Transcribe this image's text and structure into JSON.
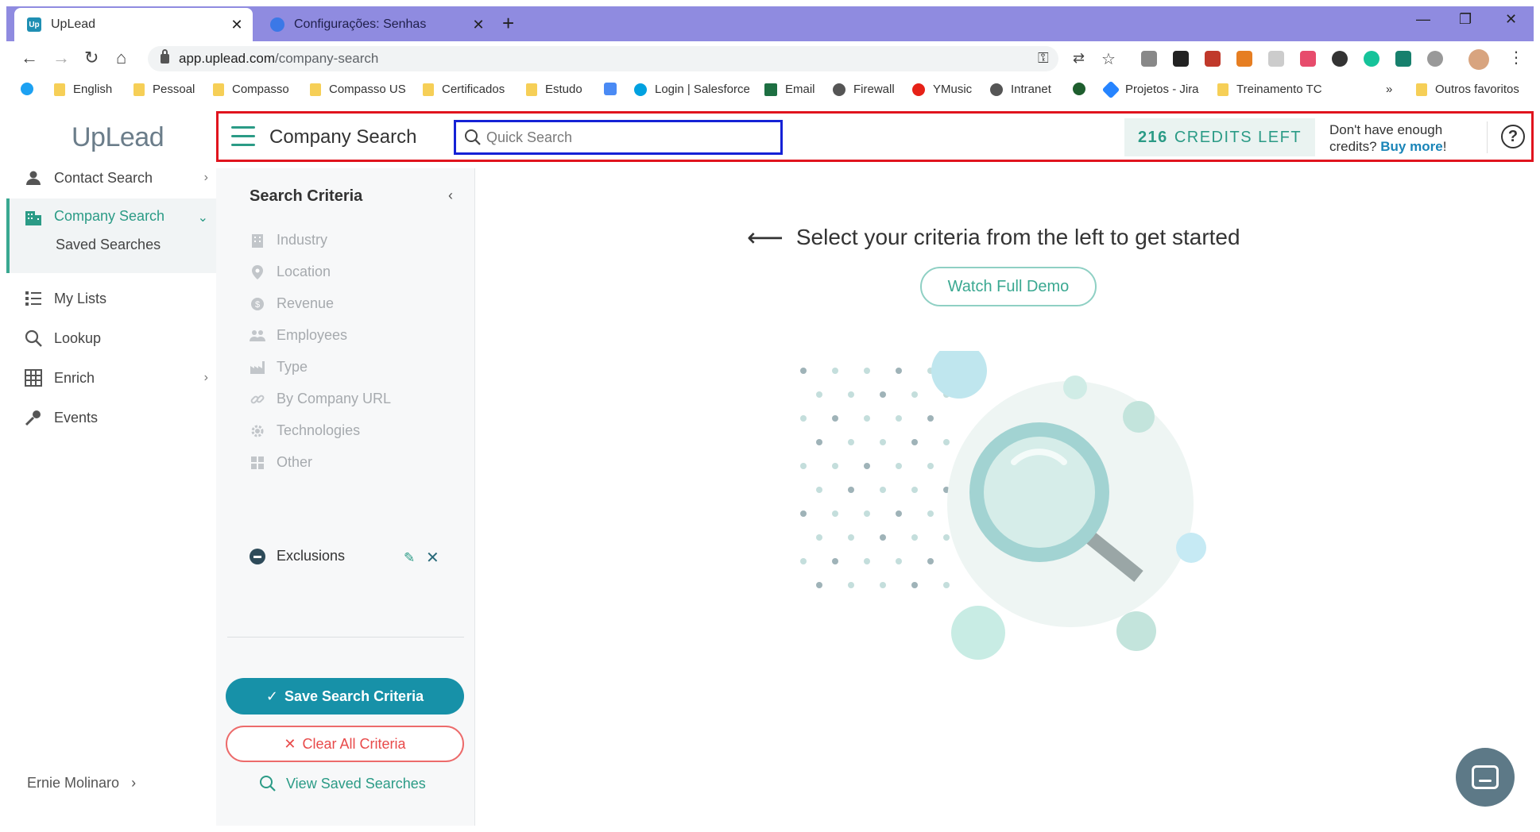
{
  "browser": {
    "tabs": [
      {
        "title": "UpLead",
        "active": true
      },
      {
        "title": "Configurações: Senhas",
        "active": false
      }
    ],
    "url_host": "app.uplead.com",
    "url_path": "/company-search",
    "bookmarks": [
      "English",
      "Pessoal",
      "Compasso",
      "Compasso US",
      "Certificados",
      "Estudo",
      "Login | Salesforce",
      "Email",
      "Firewall",
      "YMusic",
      "Intranet",
      "Projetos - Jira",
      "Treinamento TC",
      "»",
      "Outros favoritos"
    ]
  },
  "app": {
    "logo": "UpLead",
    "nav": {
      "contact_search": "Contact Search",
      "company_search": "Company Search",
      "saved_searches": "Saved Searches",
      "my_lists": "My Lists",
      "lookup": "Lookup",
      "enrich": "Enrich",
      "events": "Events"
    },
    "user_name": "Ernie Molinaro"
  },
  "header": {
    "title": "Company Search",
    "search_placeholder": "Quick Search",
    "credits_count": "216",
    "credits_label": "CREDITS LEFT",
    "credits_question": "Don't have enough credits?",
    "buy_more": "Buy more",
    "buy_more_suffix": "!"
  },
  "criteria": {
    "title": "Search Criteria",
    "items": [
      "Industry",
      "Location",
      "Revenue",
      "Employees",
      "Type",
      "By Company URL",
      "Technologies",
      "Other",
      "Exclusions"
    ],
    "save_button": "Save Search Criteria",
    "clear_button": "Clear All Criteria",
    "view_saved": "View Saved Searches"
  },
  "main": {
    "prompt": "Select your criteria from the left to get started",
    "watch_demo": "Watch Full Demo"
  },
  "colors": {
    "brand_teal": "#2b9b86",
    "button_blue": "#1791a8",
    "danger_red": "#e84a4a",
    "tab_strip": "#8f8be0"
  }
}
